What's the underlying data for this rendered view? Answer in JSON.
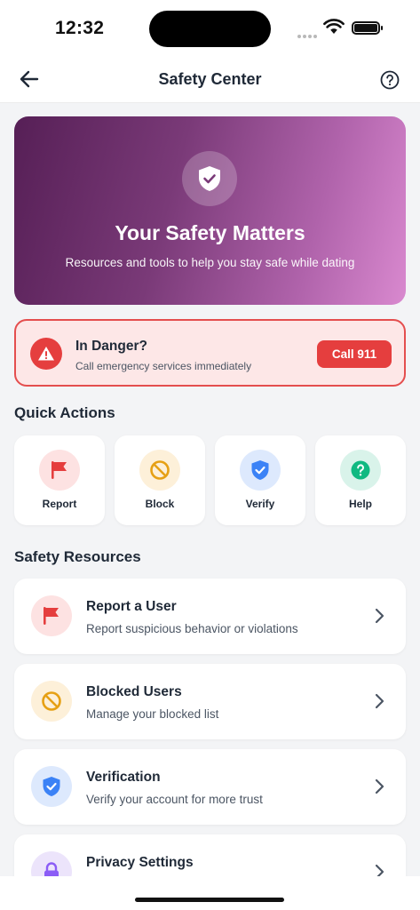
{
  "status_bar": {
    "time": "12:32"
  },
  "header": {
    "title": "Safety Center"
  },
  "hero": {
    "title": "Your Safety Matters",
    "subtitle": "Resources and tools to help you stay safe while dating"
  },
  "danger": {
    "title": "In Danger?",
    "subtitle": "Call emergency services immediately",
    "button_label": "Call 911"
  },
  "quick_actions": {
    "title": "Quick Actions",
    "items": [
      {
        "label": "Report",
        "icon": "flag-icon",
        "color": "#e53e3e",
        "bg": "#fde2e2"
      },
      {
        "label": "Block",
        "icon": "block-icon",
        "color": "#e6a014",
        "bg": "#fdf0d9"
      },
      {
        "label": "Verify",
        "icon": "verified-shield-icon",
        "color": "#3b82f6",
        "bg": "#dde9fd"
      },
      {
        "label": "Help",
        "icon": "help-circle-icon",
        "color": "#10b981",
        "bg": "#d9f3ea"
      }
    ]
  },
  "resources": {
    "title": "Safety Resources",
    "items": [
      {
        "title": "Report a User",
        "subtitle": "Report suspicious behavior or violations",
        "icon": "flag-icon"
      },
      {
        "title": "Blocked Users",
        "subtitle": "Manage your blocked list",
        "icon": "block-icon"
      },
      {
        "title": "Verification",
        "subtitle": "Verify your account for more trust",
        "icon": "verified-shield-icon"
      },
      {
        "title": "Privacy Settings",
        "subtitle": "",
        "icon": "lock-icon"
      }
    ]
  },
  "colors": {
    "danger": "#e53e3e",
    "hero_start": "#561f56",
    "hero_end": "#d989cf"
  }
}
